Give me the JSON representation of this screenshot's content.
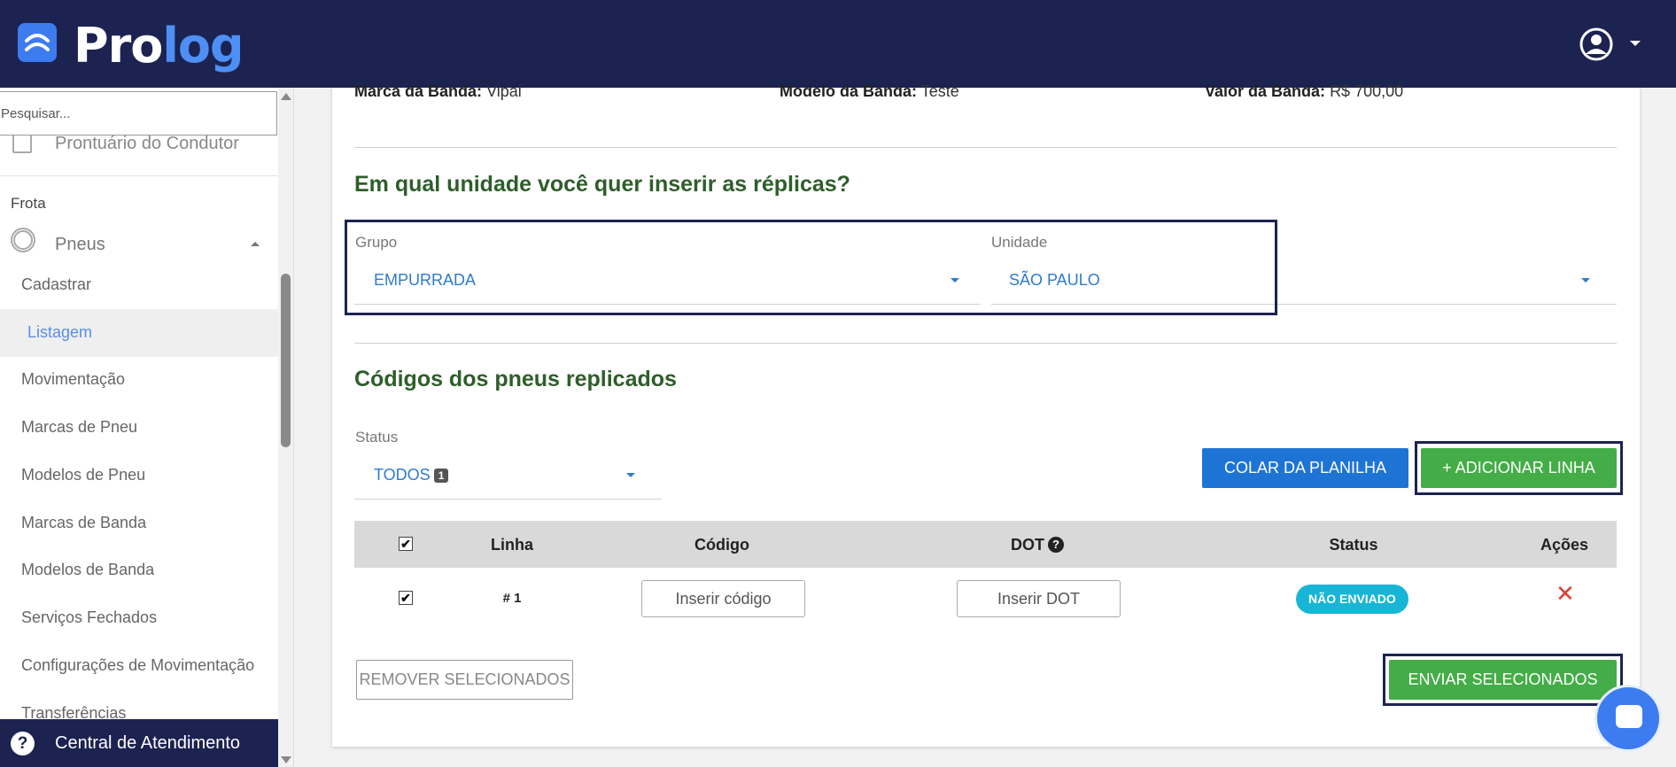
{
  "header": {
    "logo_part1": "Pro",
    "logo_part2": "log",
    "user_icon": "user-circle-icon"
  },
  "sidebar": {
    "search_placeholder": "Pesquisar...",
    "prontuario": "Prontuário do Condutor",
    "frota_section": "Frota",
    "pneus_group": "Pneus",
    "items": [
      "Cadastrar",
      "Listagem",
      "Movimentação",
      "Marcas de Pneu",
      "Modelos de Pneu",
      "Marcas de Banda",
      "Modelos de Banda",
      "Serviços Fechados",
      "Configurações de Movimentação",
      "Transferências"
    ],
    "active_item": "Listagem",
    "help": "Central de Atendimento"
  },
  "info_row": {
    "marca_label": "Marca da Banda:",
    "marca_value": "Vipal",
    "modelo_label": "Modelo da Banda:",
    "modelo_value": "Teste",
    "valor_label": "Valor da Banda:",
    "valor_value": "R$ 700,00"
  },
  "unit_section": {
    "title": "Em qual unidade você quer inserir as réplicas?",
    "grupo_label": "Grupo",
    "grupo_value": "EMPURRADA",
    "unidade_label": "Unidade",
    "unidade_value": "SÃO PAULO"
  },
  "codes_section": {
    "title": "Códigos dos pneus replicados",
    "status_label": "Status",
    "status_value": "TODOS",
    "status_count": "1",
    "paste_button": "COLAR DA PLANILHA",
    "add_button": "+ ADICIONAR LINHA",
    "columns": [
      "Linha",
      "Código",
      "DOT",
      "Status",
      "Ações"
    ],
    "rows": [
      {
        "linha": "# 1",
        "codigo_placeholder": "Inserir código",
        "dot_placeholder": "Inserir DOT",
        "status": "NÃO ENVIADO",
        "action_icon": "close-icon"
      }
    ],
    "remove_button": "REMOVER SELECIONADOS",
    "send_button": "ENVIAR SELECIONADOS"
  },
  "colors": {
    "navy": "#1c2351",
    "title_green": "#2e5e2a",
    "blue_button": "#1e74d4",
    "green_button": "#44ad47",
    "status_pill": "#17b6d6",
    "delete_red": "#e03c32"
  }
}
